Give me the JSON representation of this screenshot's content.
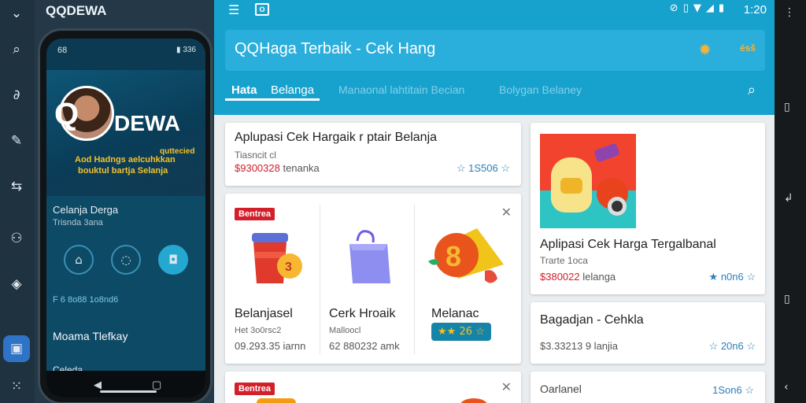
{
  "left_rail": {
    "icons": [
      "chevron-down-icon",
      "search-icon",
      "link-icon",
      "edit-icon",
      "switch-icon",
      "users-icon",
      "layers-icon",
      "image-icon",
      "grid-icon"
    ]
  },
  "phone": {
    "zone_title": "QQDEWA",
    "status_time": "68",
    "status_right": "▮ 336",
    "brand_q": "Q",
    "brand_text": "DEWA",
    "hero_line1": "Aod Hadngs aelcuhkkan",
    "hero_line2": "bouktul bartja Selanja",
    "hero_badge": "quttecied",
    "row1_title": "Celanja Derga",
    "row1_sub": "Trisnda 3ana",
    "highlight_line": "F 6 8o88 1o8nd6",
    "contact_name": "Moama Tlefkay",
    "bottom_cut": "Celeda"
  },
  "app": {
    "status_time": "1:20",
    "search_text": "QQHaga Terbaik - Cek Hang",
    "header_mini": "ésš",
    "tabs": [
      {
        "label": "Hata"
      },
      {
        "label": "Belanga"
      },
      {
        "label": "Manaonal  lahtitain  Becian"
      },
      {
        "label": "Bolygan Belaney"
      }
    ],
    "card1": {
      "title": "Aplupasi Cek Hargaik r ptair Belanja",
      "sub": "Tiasncit cl",
      "price": "$9300328",
      "price_tail": " tenanka",
      "rating": "☆ 1S506 ☆"
    },
    "card2": {
      "badge": "Bentrea",
      "close": "✕",
      "products": [
        {
          "title": "Belanjasel",
          "sub": "Het 3o0rsc2",
          "price": "09.293.35 iarnn"
        },
        {
          "title": "Cerk Hroaik",
          "sub": "Malloocl",
          "price": "62 880232 amk"
        },
        {
          "title": "Melanac",
          "rating": "★★ 26 ☆"
        }
      ]
    },
    "card3": {
      "badge": "Bentrea",
      "close": "✕"
    },
    "card4": {
      "title": "Aplipasi Cek Harga Tergalbanal",
      "sub": "Trarte 1oca",
      "price": "$380022",
      "price_tail": " lelanga",
      "rating": "★ n0n6 ☆"
    },
    "card5": {
      "title": "Bagadjan - Cehkla",
      "price": "$3.33213 9 lanjia",
      "rating": "☆ 20n6 ☆"
    },
    "card6": {
      "title": "Oarlanel",
      "rating": "1Son6 ☆"
    }
  },
  "colors": {
    "header_blue": "#17a2ce",
    "badge_red": "#d21f29",
    "rating_blue": "#2b7fb8",
    "accent_gold": "#f2b33a"
  }
}
